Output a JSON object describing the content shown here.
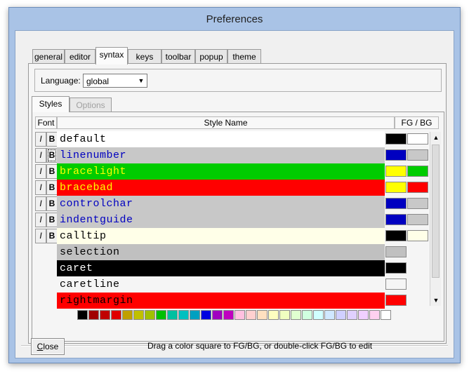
{
  "window": {
    "title": "Preferences"
  },
  "tabs": [
    {
      "label": "general"
    },
    {
      "label": "editor"
    },
    {
      "label": "syntax",
      "active": true
    },
    {
      "label": "keys"
    },
    {
      "label": "toolbar"
    },
    {
      "label": "popup"
    },
    {
      "label": "theme"
    }
  ],
  "language": {
    "label": "Language:",
    "value": "global",
    "dropdown_icon": "chevron-down-icon"
  },
  "subtabs": [
    {
      "label": "Styles",
      "active": true
    },
    {
      "label": "Options",
      "disabled": true
    }
  ],
  "headers": {
    "font": "Font",
    "style_name": "Style Name",
    "fg_bg": "FG / BG"
  },
  "italic_label": "I",
  "bold_label": "B",
  "styles": [
    {
      "name": "default",
      "text": "#000000",
      "row_bg": "#ffffff",
      "fg": "#000000",
      "bg": "#ffffff",
      "font_buttons": true
    },
    {
      "name": "linenumber",
      "text": "#0000c0",
      "row_bg": "#c8c8c8",
      "fg": "#0000c0",
      "bg": "#c8c8c8",
      "font_buttons": true
    },
    {
      "name": "bracelight",
      "text": "#ffff00",
      "row_bg": "#00cc00",
      "fg": "#ffff00",
      "bg": "#00cc00",
      "font_buttons": true
    },
    {
      "name": "bracebad",
      "text": "#ffff00",
      "row_bg": "#ff0000",
      "fg": "#ffff00",
      "bg": "#ff0000",
      "font_buttons": true
    },
    {
      "name": "controlchar",
      "text": "#0000c0",
      "row_bg": "#c8c8c8",
      "fg": "#0000c0",
      "bg": "#c8c8c8",
      "font_buttons": true
    },
    {
      "name": "indentguide",
      "text": "#0000c0",
      "row_bg": "#c8c8c8",
      "fg": "#0000c0",
      "bg": "#c8c8c8",
      "font_buttons": true
    },
    {
      "name": "calltip",
      "text": "#000000",
      "row_bg": "#ffffe8",
      "fg": "#000000",
      "bg": "#ffffe8",
      "font_buttons": true
    },
    {
      "name": "selection",
      "text": "#000000",
      "row_bg": "#c0c0c0",
      "fg": null,
      "bg": "#c0c0c0",
      "font_buttons": false
    },
    {
      "name": "caret",
      "text": "#ffffff",
      "row_bg": "#000000",
      "fg": null,
      "bg": "#000000",
      "font_buttons": false
    },
    {
      "name": "caretline",
      "text": "#000000",
      "row_bg": "#f5f5f5",
      "fg": null,
      "bg": "#f5f5f5",
      "font_buttons": false
    },
    {
      "name": "rightmargin",
      "text": "#000000",
      "row_bg": "#ff0000",
      "fg": null,
      "bg": "#ff0000",
      "font_buttons": false
    }
  ],
  "palette": [
    "#000000",
    "#a00000",
    "#c00000",
    "#e00000",
    "#c0a000",
    "#c0c000",
    "#a0c000",
    "#00c000",
    "#00c0a0",
    "#00c0c0",
    "#00a0c0",
    "#0000e0",
    "#a000c0",
    "#c000c0",
    "#ffc0e0",
    "#ffd0d0",
    "#ffe0c0",
    "#ffffc0",
    "#f0ffc0",
    "#e0ffd0",
    "#d0ffe0",
    "#d0ffff",
    "#d0e8ff",
    "#d0d0ff",
    "#e0d0ff",
    "#f0d0ff",
    "#ffd0f0",
    "#ffffff"
  ],
  "footer": {
    "close_label": "Close",
    "close_mnemonic": "C",
    "close_rest": "lose",
    "hint": "Drag a color square to FG/BG, or double-click FG/BG to edit"
  }
}
